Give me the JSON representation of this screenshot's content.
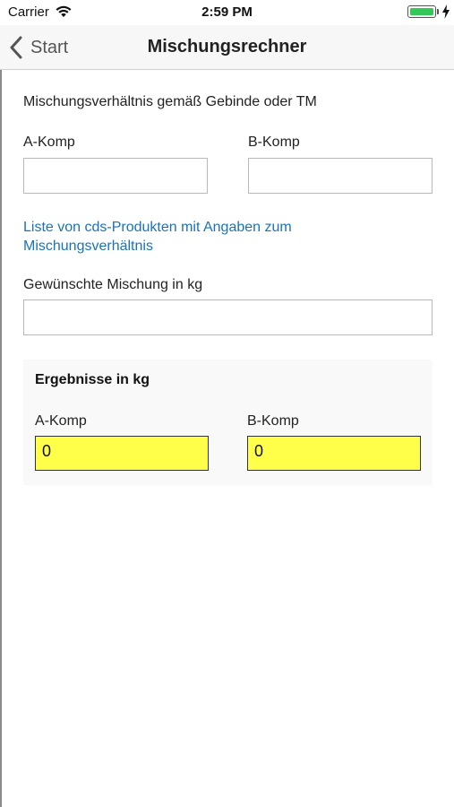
{
  "status_bar": {
    "carrier": "Carrier",
    "time": "2:59 PM",
    "battery_color": "#34c759"
  },
  "nav": {
    "back_label": "Start",
    "title": "Mischungsrechner"
  },
  "form": {
    "ratio_heading": "Mischungsverhältnis gemäß Gebinde oder TM",
    "a_label": "A-Komp",
    "a_value": "",
    "b_label": "B-Komp",
    "b_value": "",
    "link_text": "Liste von cds-Produkten mit Angaben zum Mischungsverhältnis",
    "link_color": "#1a73b8",
    "mix_label": "Gewünschte Mischung in kg",
    "mix_value": ""
  },
  "results": {
    "title": "Ergebnisse in kg",
    "a_label": "A-Komp",
    "a_value": "0",
    "b_label": "B-Komp",
    "b_value": "0",
    "highlight_color": "#ffff4a"
  },
  "icons": {
    "wifi": "wifi-icon",
    "battery": "battery-icon",
    "charging": "charging-bolt-icon",
    "back": "chevron-left-icon"
  }
}
